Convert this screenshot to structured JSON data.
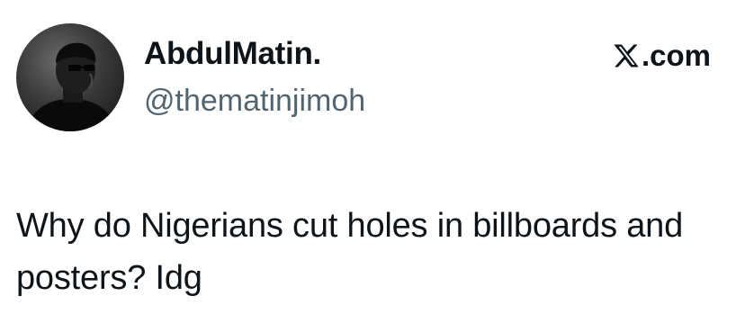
{
  "tweet": {
    "author": {
      "display_name": "AbdulMatin.",
      "handle": "@thematinjimoh",
      "avatar_icon": "profile-photo"
    },
    "source": {
      "logo_icon": "x-logo-icon",
      "label": ".com"
    },
    "text": "Why do Nigerians cut holes in billboards and posters? Idg"
  }
}
